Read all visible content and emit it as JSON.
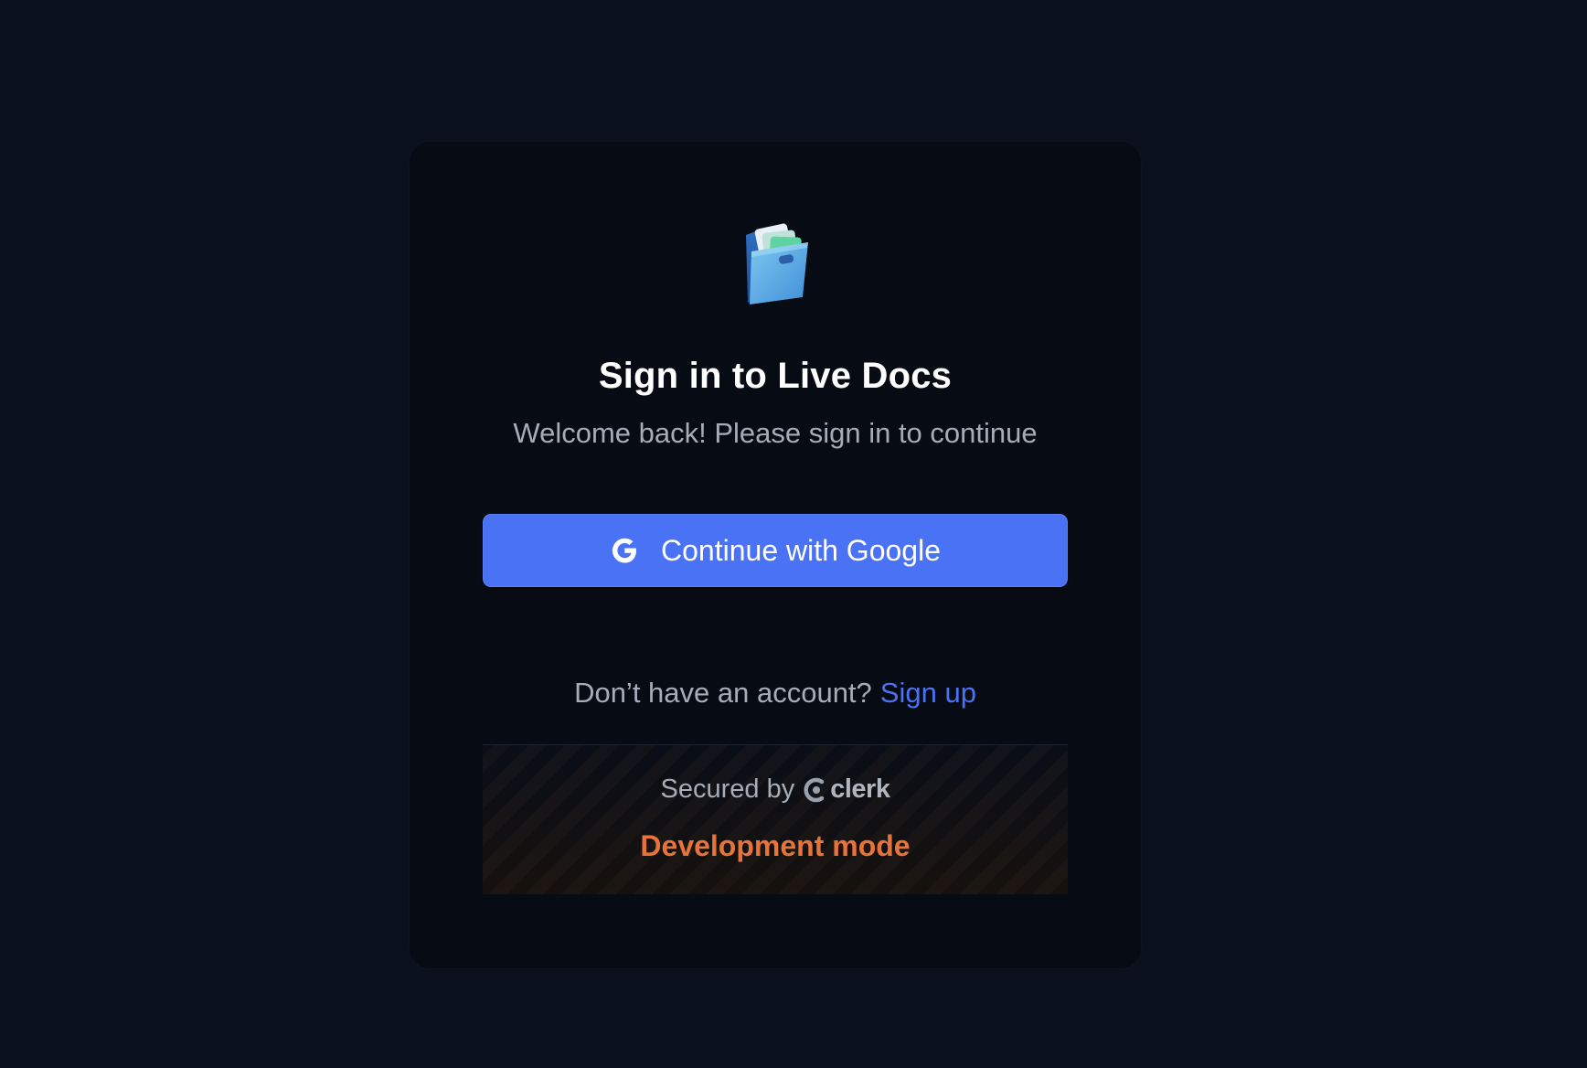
{
  "signin": {
    "logo_icon": "file-folder-icon",
    "title": "Sign in to Live Docs",
    "subtitle": "Welcome back! Please sign in to continue",
    "google_button": {
      "icon": "google-icon",
      "label": "Continue with Google"
    },
    "signup_prompt": "Don’t have an account?",
    "signup_link": "Sign up"
  },
  "footer": {
    "secured_by": "Secured by",
    "brand_icon": "clerk-icon",
    "brand_name": "clerk",
    "dev_mode": "Development mode"
  },
  "colors": {
    "background": "#0b101d",
    "card": "#060b14",
    "accent": "#4a72f5",
    "dev_mode": "#e6733a"
  }
}
